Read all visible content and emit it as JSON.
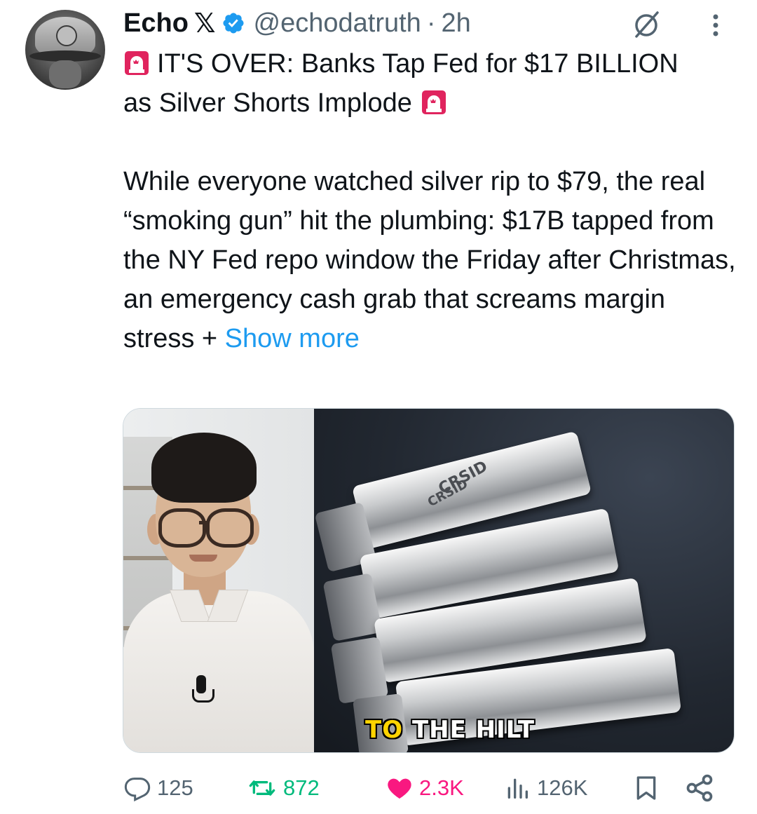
{
  "tweet": {
    "author": {
      "name": "Echo",
      "name_suffix": "𝕏",
      "handle": "@echodatruth",
      "separator": "·",
      "time": "2h"
    },
    "headline_line1": "IT'S OVER: Banks Tap Fed for $17 BILLION",
    "headline_line2": "as Silver Shorts Implode",
    "body": "While everyone watched silver rip to $79, the real “smoking gun” hit the plumbing: $17B tapped from the NY Fed repo window the Friday after Christmas, an emergency cash grab that screams margin stress +",
    "show_more": "Show more",
    "media": {
      "caption_part1": "TO",
      "caption_part2": "THE",
      "caption_part3": "HILT",
      "bar_stamp_1": "CRSID",
      "bar_stamp_2": "CRSID"
    },
    "actions": {
      "replies": "125",
      "reposts": "872",
      "likes": "2.3K",
      "views": "126K"
    }
  },
  "colors": {
    "link": "#1d9bf0",
    "muted": "#536471",
    "repost": "#00ba7c",
    "like": "#f91880",
    "verified": "#1d9bf0",
    "siren": "#e0245e",
    "caption_highlight": "#ffd400"
  },
  "icons": [
    "verified-badge-icon",
    "grok-icon",
    "more-options-icon",
    "siren-icon",
    "sound-icon",
    "reply-icon",
    "repost-icon",
    "like-icon",
    "views-icon",
    "bookmark-icon",
    "share-icon"
  ]
}
